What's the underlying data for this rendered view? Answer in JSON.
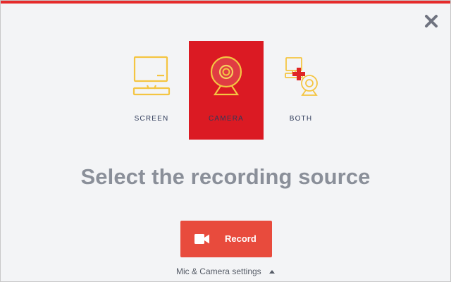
{
  "theme": {
    "accent": "#e52b2b",
    "camera_selected_bg": "#db1a23",
    "record_bg": "#e84b3d",
    "icon_yellow": "#f4c542",
    "cross_red": "#e02424",
    "label_color": "#2e3a59",
    "headline_color": "#8a8f99",
    "close_color": "#6f7380",
    "link_color": "#555b66"
  },
  "sources": [
    {
      "label": "SCREEN",
      "icon": "monitor-icon",
      "selected": false
    },
    {
      "label": "CAMERA",
      "icon": "webcam-icon",
      "selected": true
    },
    {
      "label": "BOTH",
      "icon": "monitor-plus-webcam-icon",
      "selected": false
    }
  ],
  "headline": "Select the recording source",
  "record": {
    "label": "Record",
    "icon": "video-camera-icon"
  },
  "settings": {
    "label": "Mic & Camera settings",
    "icon": "caret-up-icon"
  },
  "close": {
    "icon": "close-icon"
  }
}
